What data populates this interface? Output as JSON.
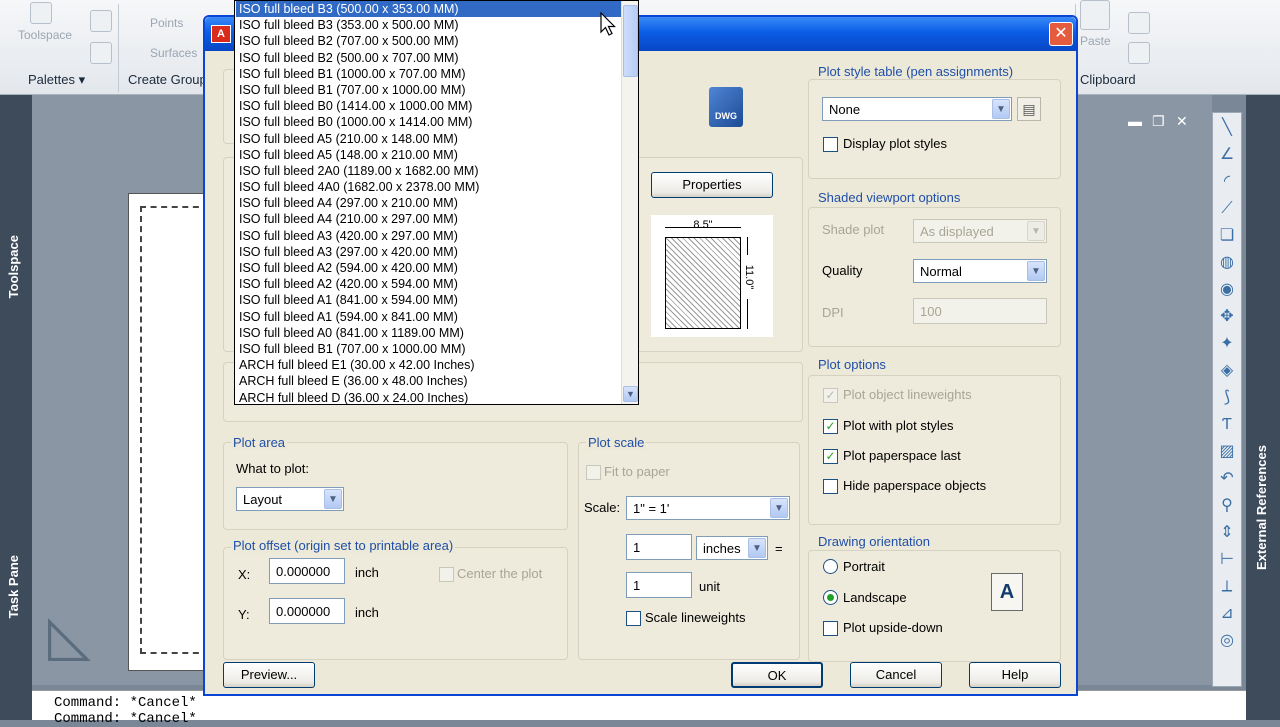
{
  "ribbon": {
    "panels": [
      "Palettes",
      "Create Group",
      "Clipboard"
    ],
    "ghost_labels": [
      "Toolspace",
      "Points",
      "Surfaces",
      "Paste"
    ]
  },
  "left_strip": {
    "toolspace": "Toolspace",
    "task_pane": "Task Pane"
  },
  "right_strip": {
    "external_references": "External References"
  },
  "command_line": {
    "lines": [
      "Command: *Cancel*",
      "Command: *Cancel*"
    ]
  },
  "dropdown": {
    "items": [
      "ISO full bleed B3 (500.00 x 353.00 MM)",
      "ISO full bleed B3 (353.00 x 500.00 MM)",
      "ISO full bleed B2 (707.00 x 500.00 MM)",
      "ISO full bleed B2 (500.00 x 707.00 MM)",
      "ISO full bleed B1 (1000.00 x 707.00 MM)",
      "ISO full bleed B1 (707.00 x 1000.00 MM)",
      "ISO full bleed B0 (1414.00 x 1000.00 MM)",
      "ISO full bleed B0 (1000.00 x 1414.00 MM)",
      "ISO full bleed A5 (210.00 x 148.00 MM)",
      "ISO full bleed A5 (148.00 x 210.00 MM)",
      "ISO full bleed 2A0 (1189.00 x 1682.00 MM)",
      "ISO full bleed 4A0 (1682.00 x 2378.00 MM)",
      "ISO full bleed A4 (297.00 x 210.00 MM)",
      "ISO full bleed A4 (210.00 x 297.00 MM)",
      "ISO full bleed A3 (420.00 x 297.00 MM)",
      "ISO full bleed A3 (297.00 x 420.00 MM)",
      "ISO full bleed A2 (594.00 x 420.00 MM)",
      "ISO full bleed A2 (420.00 x 594.00 MM)",
      "ISO full bleed A1 (841.00 x 594.00 MM)",
      "ISO full bleed A1 (594.00 x 841.00 MM)",
      "ISO full bleed A0 (841.00 x 1189.00 MM)",
      "ISO full bleed B1 (707.00 x 1000.00 MM)",
      "ARCH full bleed E1 (30.00 x 42.00 Inches)",
      "ARCH full bleed E (36.00 x 48.00 Inches)",
      "ARCH full bleed D (36.00 x 24.00 Inches)"
    ],
    "selected_index": 0
  },
  "dialog": {
    "properties_button": "Properties",
    "paper_preview": {
      "width_label": "8.5\"",
      "height_label": "11.0\""
    },
    "plot_style_table": {
      "title": "Plot style table (pen assignments)",
      "value": "None",
      "display_plot_styles": "Display plot styles"
    },
    "shaded_viewport": {
      "title": "Shaded viewport options",
      "shade_plot_label": "Shade plot",
      "shade_plot_value": "As displayed",
      "quality_label": "Quality",
      "quality_value": "Normal",
      "dpi_label": "DPI",
      "dpi_value": "100"
    },
    "plot_options": {
      "title": "Plot options",
      "items": [
        "Plot object lineweights",
        "Plot with plot styles",
        "Plot paperspace last",
        "Hide paperspace objects"
      ]
    },
    "drawing_orientation": {
      "title": "Drawing orientation",
      "portrait": "Portrait",
      "landscape": "Landscape",
      "upside_down": "Plot upside-down"
    },
    "plot_area": {
      "title": "Plot area",
      "what_to_plot_label": "What to plot:",
      "what_to_plot_value": "Layout"
    },
    "plot_offset": {
      "title": "Plot offset (origin set to printable area)",
      "x_label": "X:",
      "x_value": "0.000000",
      "y_label": "Y:",
      "y_value": "0.000000",
      "unit": "inch",
      "center": "Center the plot"
    },
    "plot_scale": {
      "title": "Plot scale",
      "fit_to_paper": "Fit to paper",
      "scale_label": "Scale:",
      "scale_value": "1\" = 1'",
      "num_value": "1",
      "num_unit": "inches",
      "equals": "=",
      "den_value": "1",
      "den_unit": "unit",
      "scale_lineweights": "Scale lineweights"
    },
    "buttons": {
      "preview": "Preview...",
      "ok": "OK",
      "cancel": "Cancel",
      "help": "Help"
    }
  }
}
